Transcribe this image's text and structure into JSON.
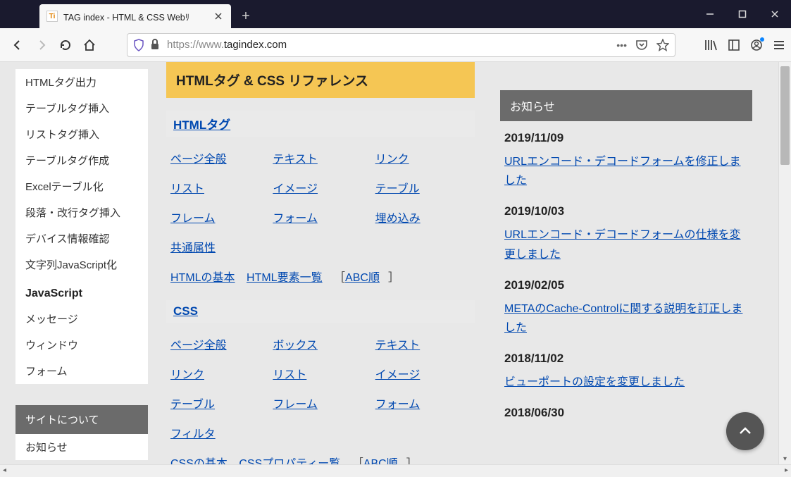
{
  "browser": {
    "tab_title": "TAG index - HTML & CSS Webﾘ",
    "tab_favicon": "Ti",
    "url_prefix": "https://www.",
    "url_domain": "tagindex.com"
  },
  "sidebar": {
    "items1": [
      "HTMLタグ出力",
      "テーブルタグ挿入",
      "リストタグ挿入",
      "テーブルタグ作成",
      "Excelテーブル化",
      "段落・改行タグ挿入",
      "デバイス情報確認",
      "文字列JavaScript化"
    ],
    "head2": "JavaScript",
    "items2": [
      "メッセージ",
      "ウィンドウ",
      "フォーム"
    ],
    "about_head": "サイトについて",
    "about_items": [
      "お知らせ"
    ]
  },
  "main": {
    "title": "HTMLタグ & CSS リファレンス",
    "html_head": "HTMLタグ",
    "html_links": [
      "ページ全般",
      "テキスト",
      "リンク",
      "リスト",
      "イメージ",
      "テーブル",
      "フレーム",
      "フォーム",
      "埋め込み",
      "共通属性"
    ],
    "html_sub": {
      "a": "HTMLの基本",
      "b": "HTML要素一覧",
      "bracket_open": "［",
      "c": "ABC順",
      "bracket_close": "］"
    },
    "css_head": "CSS",
    "css_links": [
      "ページ全般",
      "ボックス",
      "テキスト",
      "リンク",
      "リスト",
      "イメージ",
      "テーブル",
      "フレーム",
      "フォーム",
      "フィルタ"
    ],
    "css_sub": {
      "a": "CSSの基本",
      "b": "CSSプロパティー覧",
      "bracket_open": "［",
      "c": "ABC順",
      "bracket_close": "］"
    }
  },
  "news": {
    "head": "お知らせ",
    "items": [
      {
        "date": "2019/11/09",
        "text": "URLエンコード・デコードフォームを修正しました"
      },
      {
        "date": "2019/10/03",
        "text": "URLエンコード・デコードフォームの仕様を変更しました"
      },
      {
        "date": "2019/02/05",
        "text": "METAのCache-Controlに関する説明を訂正しました"
      },
      {
        "date": "2018/11/02",
        "text": "ビューポートの設定を変更しました"
      },
      {
        "date": "2018/06/30",
        "text": ""
      }
    ]
  }
}
